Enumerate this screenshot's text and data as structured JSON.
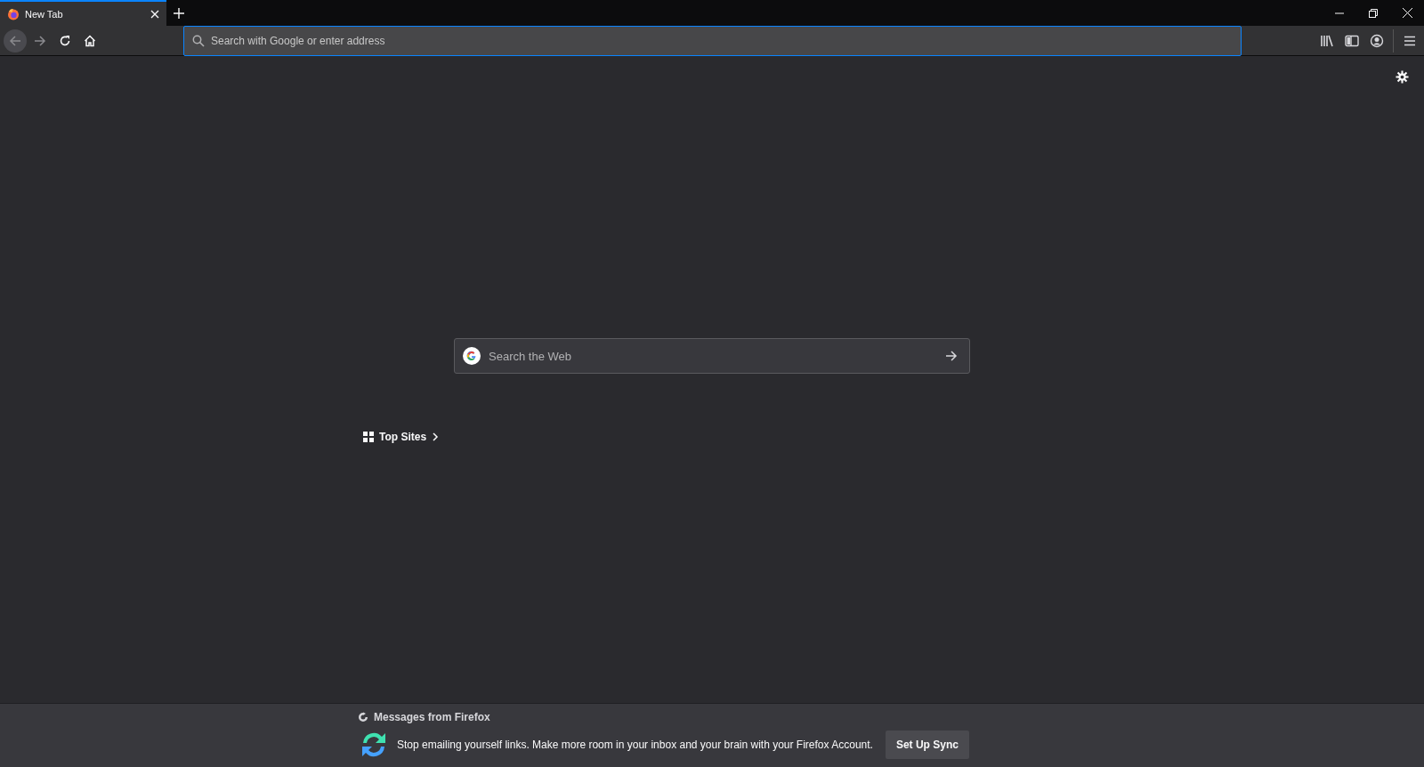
{
  "tabs": [
    {
      "title": "New Tab",
      "selected": true
    }
  ],
  "address_bar": {
    "placeholder": "Search with Google or enter address"
  },
  "search": {
    "placeholder": "Search the Web"
  },
  "top_sites": {
    "label": "Top Sites"
  },
  "messages": {
    "title": "Messages from Firefox",
    "text": "Stop emailing yourself links. Make more room in your inbox and your brain with your Firefox Account.",
    "button": "Set Up Sync"
  }
}
